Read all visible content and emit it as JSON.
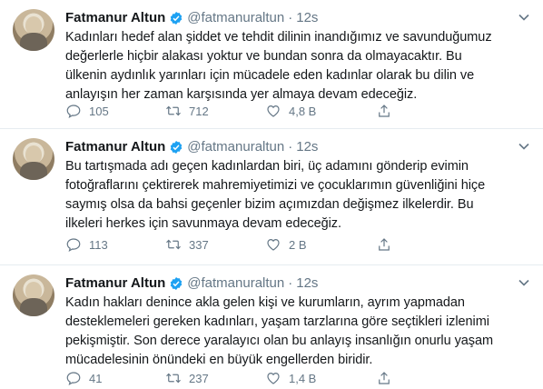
{
  "tweets": [
    {
      "author": "Fatmanur Altun",
      "handle": "@fatmanuraltun",
      "separator": "·",
      "time": "12s",
      "text": "Kadınları hedef alan şiddet ve tehdit dilinin inandığımız ve savunduğumuz\ndeğerlerle hiçbir alakası yoktur ve bundan sonra da olmayacaktır. Bu\nülkenin aydınlık yarınları için mücadele eden kadınlar olarak bu dilin ve\nanlayışın her zaman karşısında yer almaya devam edeceğiz.",
      "replies": "105",
      "retweets": "712",
      "likes": "4,8 B"
    },
    {
      "author": "Fatmanur Altun",
      "handle": "@fatmanuraltun",
      "separator": "·",
      "time": "12s",
      "text": "Bu tartışmada adı geçen kadınlardan biri, üç adamını gönderip evimin\nfotoğraflarını çektirerek  mahremiyetimizi ve çocuklarımın güvenliğini hiçe\nsaymış olsa da bahsi geçenler bizim açımızdan değişmez ilkelerdir. Bu\nilkeleri herkes için savunmaya devam edeceğiz.",
      "replies": "113",
      "retweets": "337",
      "likes": "2 B"
    },
    {
      "author": "Fatmanur Altun",
      "handle": "@fatmanuraltun",
      "separator": "·",
      "time": "12s",
      "text": "Kadın hakları denince akla gelen kişi ve kurumların, ayrım yapmadan\ndesteklemeleri gereken kadınları, yaşam tarzlarına göre seçtikleri izlenimi\npekişmiştir. Son derece yaralayıcı olan bu anlayış insanlığın onurlu yaşam\nmücadelesinin önündeki en büyük engellerden biridir.",
      "replies": "41",
      "retweets": "237",
      "likes": "1,4 B"
    }
  ],
  "colors": {
    "text": "#14171a",
    "muted": "#657786",
    "verified": "#1da1f2",
    "divider": "#e6ecf0"
  },
  "icons": [
    "verified-badge-icon",
    "caret-down-icon",
    "reply-icon",
    "retweet-icon",
    "like-icon",
    "share-icon"
  ]
}
